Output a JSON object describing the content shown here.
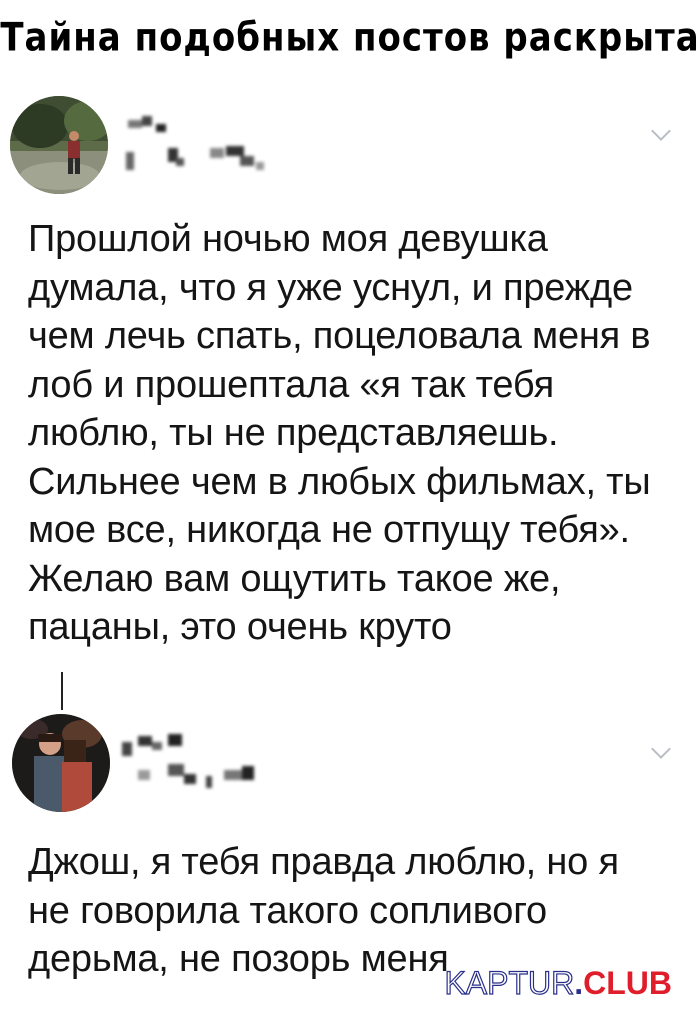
{
  "headline": "Тайна подобных постов раскрыта",
  "tweets": [
    {
      "text": "Прошлой ночью моя девушка думала, что я уже уснул, и прежде чем лечь спать, поцеловала меня в лоб и прошептала «я так тебя люблю, ты не представляешь. Сильнее чем в любых фильмах, ты мое все, никогда не отпущу тебя». Желаю вам ощутить такое же, пацаны, это очень круто"
    },
    {
      "text": "Джош, я тебя правда люблю, но я не говорила такого сопливого дерьма, не позорь меня"
    }
  ],
  "watermark": {
    "part1": "KAPTUR",
    "dot": ".",
    "part2": "CLUB"
  },
  "colors": {
    "chevron": "#b9bec4",
    "watermark_blue": "#2a2f8a",
    "watermark_red": "#e01e2b"
  }
}
